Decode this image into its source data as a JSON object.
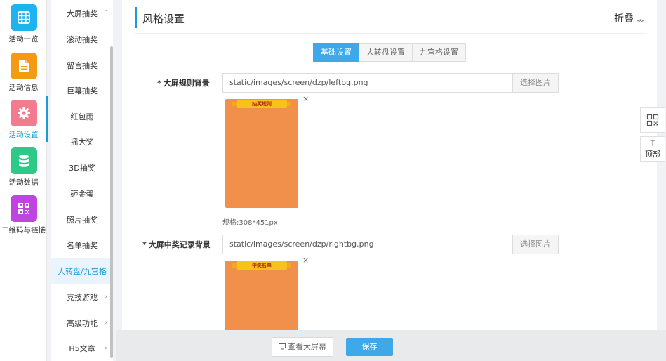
{
  "rail": [
    {
      "label": "活动一览",
      "icon": "grid-icon",
      "color": "#1eb2ee"
    },
    {
      "label": "活动信息",
      "icon": "document-icon",
      "color": "#f59a13"
    },
    {
      "label": "活动设置",
      "icon": "gear-icon",
      "color": "#f47b8e"
    },
    {
      "label": "活动数据",
      "icon": "database-icon",
      "color": "#2ec986"
    },
    {
      "label": "二维码与链接",
      "icon": "qrcode-icon",
      "color": "#c045e0"
    }
  ],
  "submenu": [
    {
      "label": "大屏抽奖",
      "arrow": "˅"
    },
    {
      "label": "滚动抽奖"
    },
    {
      "label": "留言抽奖"
    },
    {
      "label": "巨幕抽奖"
    },
    {
      "label": "红包雨"
    },
    {
      "label": "摇大奖"
    },
    {
      "label": "3D抽奖"
    },
    {
      "label": "砸金蛋"
    },
    {
      "label": "照片抽奖"
    },
    {
      "label": "名单抽奖"
    },
    {
      "label": "大转盘/九宫格"
    },
    {
      "label": "竞技游戏",
      "arrow": "›"
    },
    {
      "label": "高级功能",
      "arrow": "›"
    },
    {
      "label": "H5文章",
      "arrow": "›"
    }
  ],
  "panel": {
    "title": "风格设置",
    "fold_label": "折叠",
    "fold_chevron": "︽"
  },
  "tabs": [
    "基础设置",
    "大转盘设置",
    "九宫格设置"
  ],
  "fields": [
    {
      "required": "*",
      "label": "大屏规则背景",
      "value": "static/images/screen/dzp/leftbg.png",
      "pick_label": "选择图片",
      "banner_text": "抽奖规则",
      "spec": "规格:308*451px"
    },
    {
      "required": "*",
      "label": "大屏中奖记录背景",
      "value": "static/images/screen/dzp/rightbg.png",
      "pick_label": "选择图片",
      "banner_text": "中奖名单"
    }
  ],
  "close_glyph": "×",
  "bottom": {
    "view_label": "查看大屏幕",
    "save_label": "保存"
  },
  "floating": {
    "top_label": "顶部",
    "top_arrow": "干"
  },
  "colors": {
    "accent": "#3fa8e8",
    "active_text": "#1e9bd7",
    "preview_fill": "#f0904a"
  }
}
